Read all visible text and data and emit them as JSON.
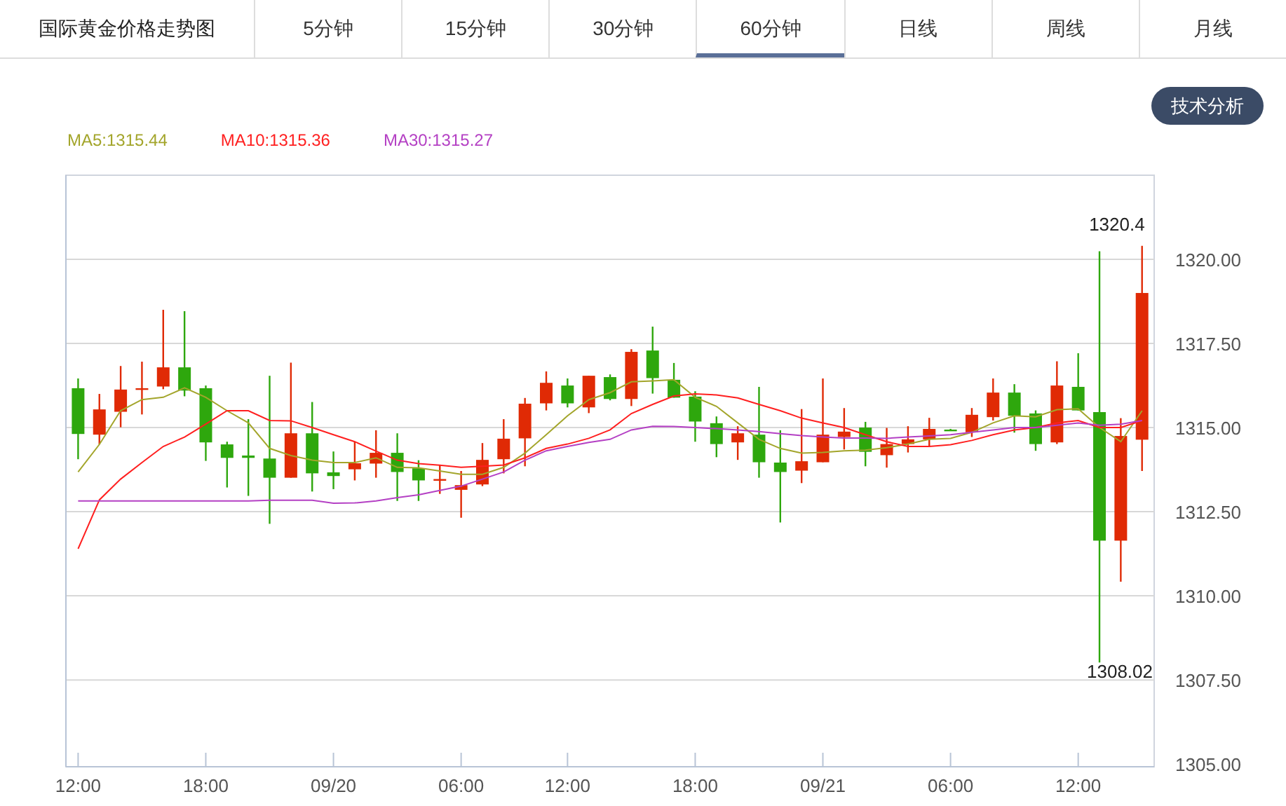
{
  "header": {
    "title": "国际黄金价格走势图"
  },
  "tabs": [
    {
      "label": "5分钟",
      "selected": false
    },
    {
      "label": "15分钟",
      "selected": false
    },
    {
      "label": "30分钟",
      "selected": false
    },
    {
      "label": "60分钟",
      "selected": true
    },
    {
      "label": "日线",
      "selected": false
    },
    {
      "label": "周线",
      "selected": false
    },
    {
      "label": "月线",
      "selected": false
    }
  ],
  "analysis_button": "技术分析",
  "chart": {
    "chart_data": {
      "type": "candlestick",
      "categories": [
        "12:00",
        null,
        null,
        null,
        null,
        null,
        "18:00",
        null,
        null,
        null,
        null,
        null,
        "09/20",
        null,
        null,
        null,
        null,
        null,
        "06:00",
        null,
        null,
        null,
        null,
        "12:00",
        null,
        null,
        null,
        null,
        null,
        "18:00",
        null,
        null,
        null,
        null,
        null,
        "09/21",
        null,
        null,
        null,
        null,
        null,
        "06:00",
        null,
        null,
        null,
        null,
        null,
        "12:00",
        null,
        null,
        null
      ],
      "ohlc": [
        [
          1316.17,
          1316.46,
          1314.06,
          1314.81
        ],
        [
          1314.79,
          1316.0,
          1314.5,
          1315.54
        ],
        [
          1315.47,
          1316.83,
          1315.01,
          1316.13
        ],
        [
          1316.15,
          1316.96,
          1315.39,
          1316.17
        ],
        [
          1316.22,
          1318.5,
          1316.14,
          1316.79
        ],
        [
          1316.79,
          1318.46,
          1315.93,
          1316.1
        ],
        [
          1316.17,
          1316.25,
          1314.01,
          1314.56
        ],
        [
          1314.5,
          1314.58,
          1313.22,
          1314.1
        ],
        [
          1314.17,
          1315.25,
          1312.97,
          1314.1
        ],
        [
          1314.08,
          1316.54,
          1312.14,
          1313.51
        ],
        [
          1313.51,
          1316.93,
          1313.51,
          1314.83
        ],
        [
          1314.83,
          1315.76,
          1313.1,
          1313.64
        ],
        [
          1313.67,
          1314.29,
          1313.17,
          1313.56
        ],
        [
          1313.76,
          1314.58,
          1313.43,
          1313.94
        ],
        [
          1313.93,
          1314.92,
          1313.51,
          1314.25
        ],
        [
          1314.25,
          1314.83,
          1312.82,
          1313.68
        ],
        [
          1313.79,
          1314.03,
          1312.82,
          1313.43
        ],
        [
          1313.46,
          1313.88,
          1313.03,
          1313.47
        ],
        [
          1313.15,
          1313.71,
          1312.32,
          1313.29
        ],
        [
          1313.31,
          1314.54,
          1313.26,
          1314.04
        ],
        [
          1314.06,
          1315.25,
          1313.64,
          1314.67
        ],
        [
          1314.68,
          1315.88,
          1313.85,
          1315.71
        ],
        [
          1315.72,
          1316.67,
          1315.51,
          1316.33
        ],
        [
          1316.25,
          1316.46,
          1315.6,
          1315.72
        ],
        [
          1315.6,
          1316.54,
          1315.43,
          1316.54
        ],
        [
          1316.5,
          1316.58,
          1315.81,
          1315.85
        ],
        [
          1315.85,
          1317.33,
          1315.64,
          1317.25
        ],
        [
          1317.29,
          1318.0,
          1316.01,
          1316.47
        ],
        [
          1316.42,
          1316.92,
          1315.89,
          1315.89
        ],
        [
          1315.92,
          1316.08,
          1314.58,
          1315.18
        ],
        [
          1315.13,
          1315.33,
          1314.12,
          1314.51
        ],
        [
          1314.56,
          1315.04,
          1314.04,
          1314.83
        ],
        [
          1314.79,
          1316.21,
          1313.51,
          1313.97
        ],
        [
          1313.96,
          1314.92,
          1312.18,
          1313.68
        ],
        [
          1313.72,
          1315.55,
          1313.35,
          1314.0
        ],
        [
          1313.97,
          1316.46,
          1313.97,
          1314.79
        ],
        [
          1314.72,
          1315.58,
          1314.35,
          1314.88
        ],
        [
          1315.0,
          1315.17,
          1313.85,
          1314.28
        ],
        [
          1314.18,
          1314.99,
          1313.81,
          1314.51
        ],
        [
          1314.51,
          1315.04,
          1314.26,
          1314.65
        ],
        [
          1314.65,
          1315.29,
          1314.43,
          1314.96
        ],
        [
          1314.94,
          1314.96,
          1314.92,
          1314.93
        ],
        [
          1314.86,
          1315.58,
          1314.72,
          1315.38
        ],
        [
          1315.31,
          1316.46,
          1315.21,
          1316.04
        ],
        [
          1316.04,
          1316.29,
          1314.85,
          1315.35
        ],
        [
          1315.42,
          1315.51,
          1314.31,
          1314.51
        ],
        [
          1314.56,
          1316.97,
          1314.51,
          1316.25
        ],
        [
          1316.21,
          1317.21,
          1315.51,
          1315.51
        ],
        [
          1315.46,
          1320.24,
          1308.02,
          1311.64
        ],
        [
          1311.64,
          1315.28,
          1310.42,
          1314.75
        ],
        [
          1314.64,
          1320.4,
          1313.71,
          1319.0
        ]
      ],
      "series": [
        {
          "name": "MA5:1315.44",
          "type": "line",
          "color": "#a3a52b",
          "values": [
            1313.68,
            1314.5,
            1315.5,
            1315.83,
            1315.9,
            1316.18,
            1315.9,
            1315.5,
            1315.14,
            1314.38,
            1314.17,
            1314.03,
            1313.96,
            1313.96,
            1314.1,
            1313.82,
            1313.8,
            1313.71,
            1313.61,
            1313.61,
            1313.82,
            1314.24,
            1314.79,
            1315.35,
            1315.83,
            1316.04,
            1316.36,
            1316.39,
            1316.42,
            1315.9,
            1315.63,
            1315.14,
            1314.65,
            1314.38,
            1314.24,
            1314.26,
            1314.31,
            1314.33,
            1314.4,
            1314.51,
            1314.65,
            1314.68,
            1314.86,
            1315.14,
            1315.35,
            1315.32,
            1315.53,
            1315.56,
            1315.0,
            1314.58,
            1315.5
          ]
        },
        {
          "name": "MA10:1315.36",
          "type": "line",
          "color": "#ff1f1f",
          "values": [
            1311.4,
            1312.85,
            1313.47,
            1313.96,
            1314.44,
            1314.72,
            1315.1,
            1315.5,
            1315.5,
            1315.21,
            1315.2,
            1315.0,
            1314.79,
            1314.58,
            1314.3,
            1314.03,
            1313.93,
            1313.88,
            1313.82,
            1313.85,
            1313.89,
            1314.1,
            1314.38,
            1314.51,
            1314.68,
            1314.93,
            1315.42,
            1315.69,
            1315.94,
            1316.0,
            1315.97,
            1315.88,
            1315.69,
            1315.5,
            1315.28,
            1315.14,
            1315.0,
            1314.79,
            1314.58,
            1314.44,
            1314.44,
            1314.49,
            1314.62,
            1314.79,
            1314.93,
            1315.0,
            1315.14,
            1315.21,
            1315.0,
            1315.0,
            1315.21
          ]
        },
        {
          "name": "MA30:1315.27",
          "type": "line",
          "color": "#b440c4",
          "values": [
            1312.82,
            1312.82,
            1312.82,
            1312.82,
            1312.82,
            1312.82,
            1312.82,
            1312.82,
            1312.82,
            1312.84,
            1312.84,
            1312.84,
            1312.75,
            1312.76,
            1312.82,
            1312.92,
            1313.0,
            1313.13,
            1313.26,
            1313.47,
            1313.68,
            1314.03,
            1314.31,
            1314.44,
            1314.56,
            1314.65,
            1314.93,
            1315.04,
            1315.03,
            1315.0,
            1314.97,
            1314.93,
            1314.88,
            1314.82,
            1314.76,
            1314.72,
            1314.69,
            1314.69,
            1314.68,
            1314.72,
            1314.75,
            1314.79,
            1314.86,
            1314.93,
            1315.0,
            1315.0,
            1315.07,
            1315.14,
            1315.07,
            1315.1,
            1315.21
          ]
        }
      ],
      "ylim": [
        1304.92,
        1322.5
      ],
      "yticks": [
        {
          "value": 1305,
          "label": "1305.00"
        },
        {
          "value": 1307.5,
          "label": "1307.50"
        },
        {
          "value": 1310,
          "label": "1310.00"
        },
        {
          "value": 1312.5,
          "label": "1312.50"
        },
        {
          "value": 1315,
          "label": "1315.00"
        },
        {
          "value": 1317.5,
          "label": "1317.50"
        },
        {
          "value": 1320,
          "label": "1320.00"
        }
      ],
      "grid": true,
      "annotations": [
        "1320.4",
        "1308.02"
      ]
    }
  }
}
